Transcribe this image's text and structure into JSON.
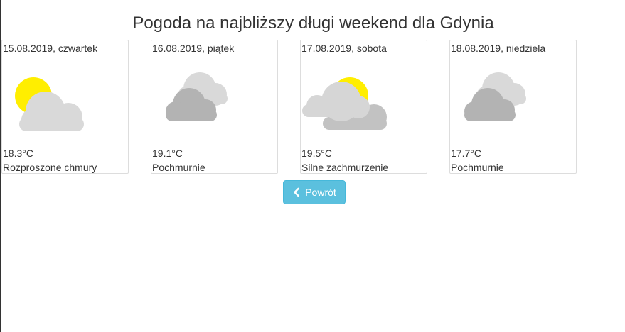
{
  "page": {
    "title": "Pogoda na najbliższy długi weekend dla Gdynia"
  },
  "forecast": [
    {
      "date": "15.08.2019, czwartek",
      "temperature": "18.3°C",
      "description": "Rozproszone chmury",
      "icon": "sun-behind-cloud-icon"
    },
    {
      "date": "16.08.2019, piątek",
      "temperature": "19.1°C",
      "description": "Pochmurnie",
      "icon": "overcast-clouds-icon"
    },
    {
      "date": "17.08.2019, sobota",
      "temperature": "19.5°C",
      "description": "Silne zachmurzenie",
      "icon": "broken-clouds-sun-icon"
    },
    {
      "date": "18.08.2019, niedziela",
      "temperature": "17.7°C",
      "description": "Pochmurnie",
      "icon": "overcast-clouds-icon"
    }
  ],
  "actions": {
    "back_label": "Powrót",
    "back_icon": "chevron-left-icon"
  },
  "colors": {
    "button_bg": "#5bc0de",
    "sun": "#ffee00",
    "cloud_light": "#d9d9d9",
    "cloud_dark": "#b3b3b3"
  }
}
